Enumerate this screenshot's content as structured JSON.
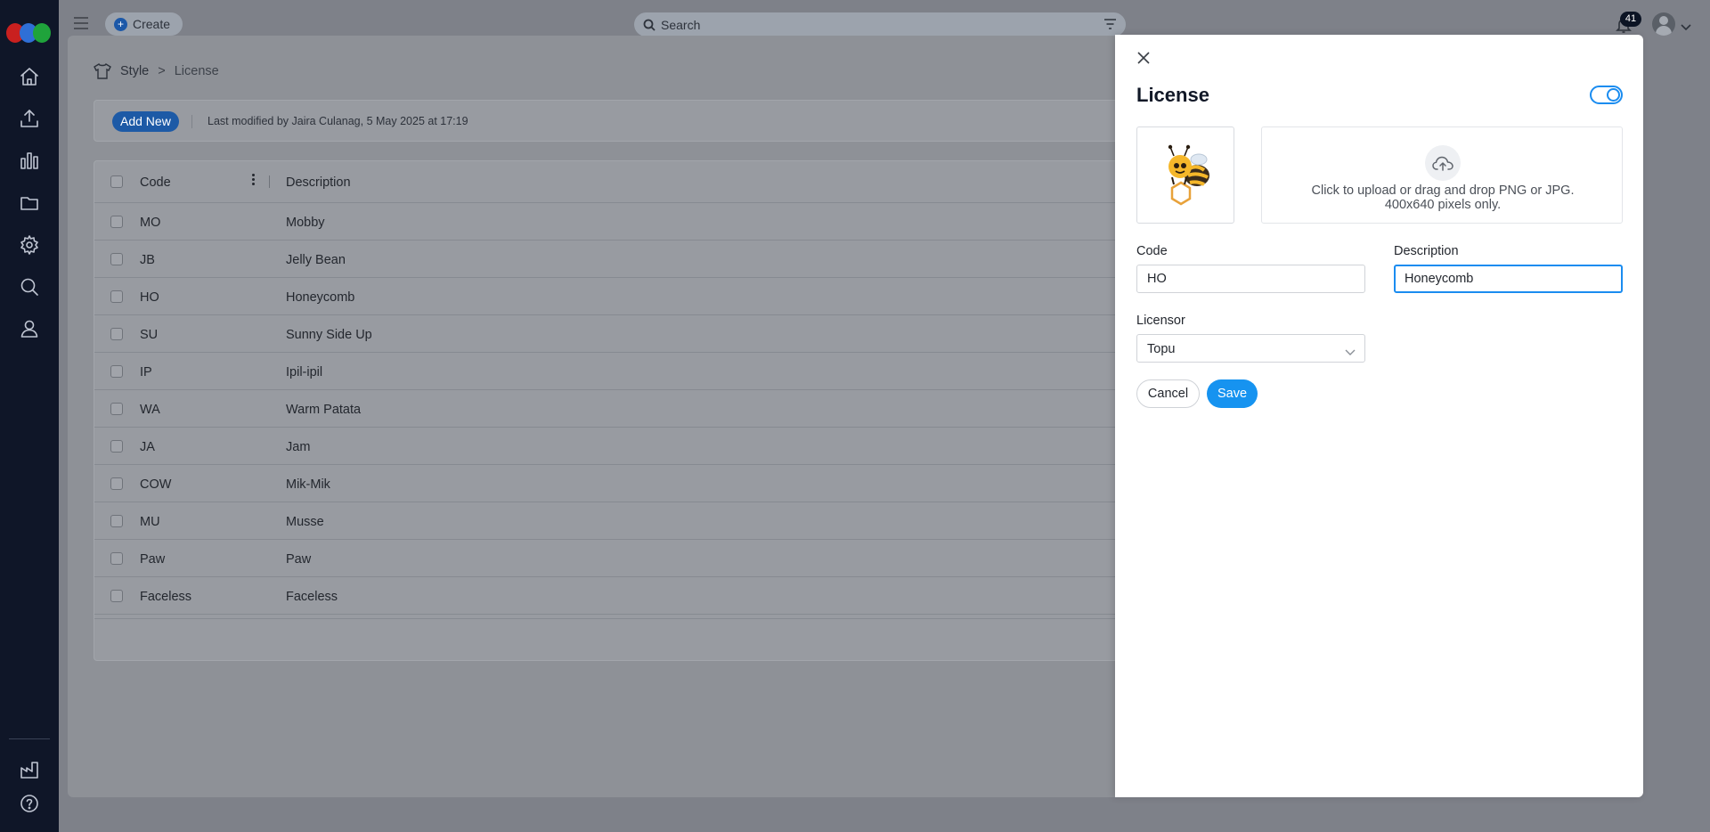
{
  "app": {
    "create_label": "Create",
    "search_placeholder": "Search",
    "notification_count": "41"
  },
  "breadcrumb": {
    "root": "Style",
    "separator": ">",
    "current": "License"
  },
  "toolbar": {
    "add_new_label": "Add New",
    "last_modified": "Last modified by Jaira Culanag, 5 May 2025 at 17:19"
  },
  "table": {
    "columns": [
      "Code",
      "Description"
    ],
    "rows": [
      {
        "code": "MO",
        "description": "Mobby"
      },
      {
        "code": "JB",
        "description": "Jelly Bean"
      },
      {
        "code": "HO",
        "description": "Honeycomb"
      },
      {
        "code": "SU",
        "description": "Sunny Side Up"
      },
      {
        "code": "IP",
        "description": "Ipil-ipil"
      },
      {
        "code": "WA",
        "description": "Warm Patata"
      },
      {
        "code": "JA",
        "description": "Jam"
      },
      {
        "code": "COW",
        "description": "Mik-Mik"
      },
      {
        "code": "MU",
        "description": "Musse"
      },
      {
        "code": "Paw",
        "description": "Paw"
      },
      {
        "code": "Faceless",
        "description": "Faceless"
      }
    ]
  },
  "drawer": {
    "title": "License",
    "active_toggle_on": true,
    "upload_text": "Click to upload or drag and drop PNG or JPG. 400x640 pixels only.",
    "code_label": "Code",
    "code_value": "HO",
    "description_label": "Description",
    "description_value": "Honeycomb",
    "licensor_label": "Licensor",
    "licensor_value": "Topu",
    "cancel_label": "Cancel",
    "save_label": "Save"
  },
  "colors": {
    "sidebar": "#0f1628",
    "primary": "#1693f0",
    "overlay": "#7e8189"
  }
}
